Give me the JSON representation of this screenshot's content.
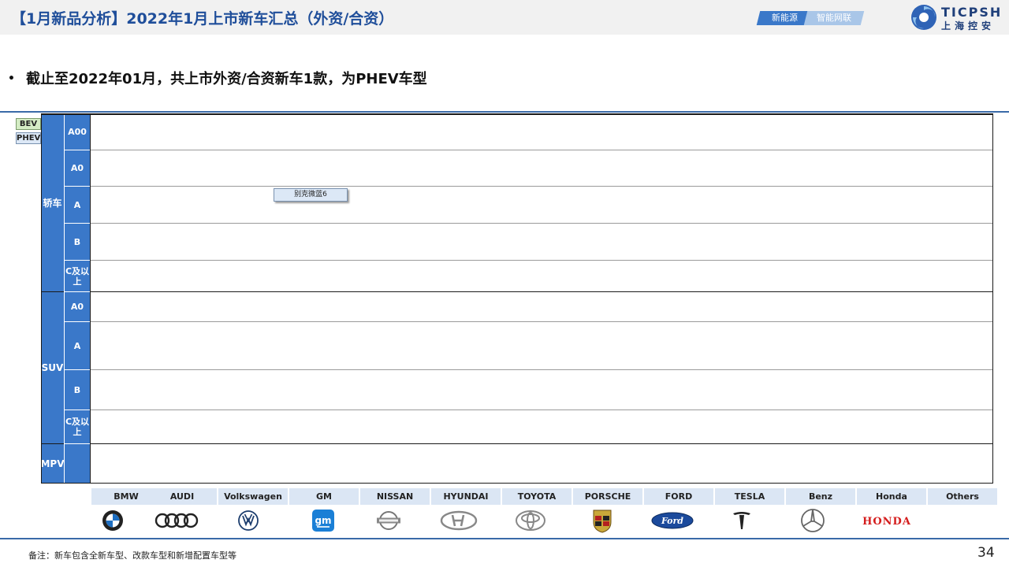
{
  "header": {
    "title": "【1月新品分析】2022年1月上市新车汇总（外资/合资）",
    "tags": [
      "新能源",
      "智能网联"
    ],
    "logo_en": "TICPSH",
    "logo_cn": "上海控安"
  },
  "summary": "截止至2022年01月，共上市外资/合资新车1款，为PHEV车型",
  "legend": [
    "BEV",
    "PHEV"
  ],
  "categories": {
    "sedan": "轿车",
    "suv": "SUV",
    "mpv": "MPV"
  },
  "segments": {
    "sedan": [
      "A00",
      "A0",
      "A",
      "B",
      "C及以上"
    ],
    "suv": [
      "A0",
      "A",
      "B",
      "C及以上"
    ]
  },
  "models": [
    {
      "name": "别克微蓝6",
      "type": "PHEV",
      "category": "轿车",
      "segment": "A"
    }
  ],
  "brands": [
    "BMW",
    "AUDI",
    "Volkswagen",
    "GM",
    "NISSAN",
    "HYUNDAI",
    "TOYOTA",
    "PORSCHE",
    "FORD",
    "TESLA",
    "Benz",
    "Honda",
    "Others"
  ],
  "brand_logo_text": {
    "gm": "gm",
    "ford": "Ford",
    "honda": "HONDA"
  },
  "footer": {
    "note": "备注：新车包含全新车型、改款车型和新增配置车型等",
    "page": "34"
  },
  "colors": {
    "primary": "#3a78c9",
    "title": "#1f4e9a",
    "phev": "#dce8f6",
    "bev": "#d4ecc4"
  }
}
